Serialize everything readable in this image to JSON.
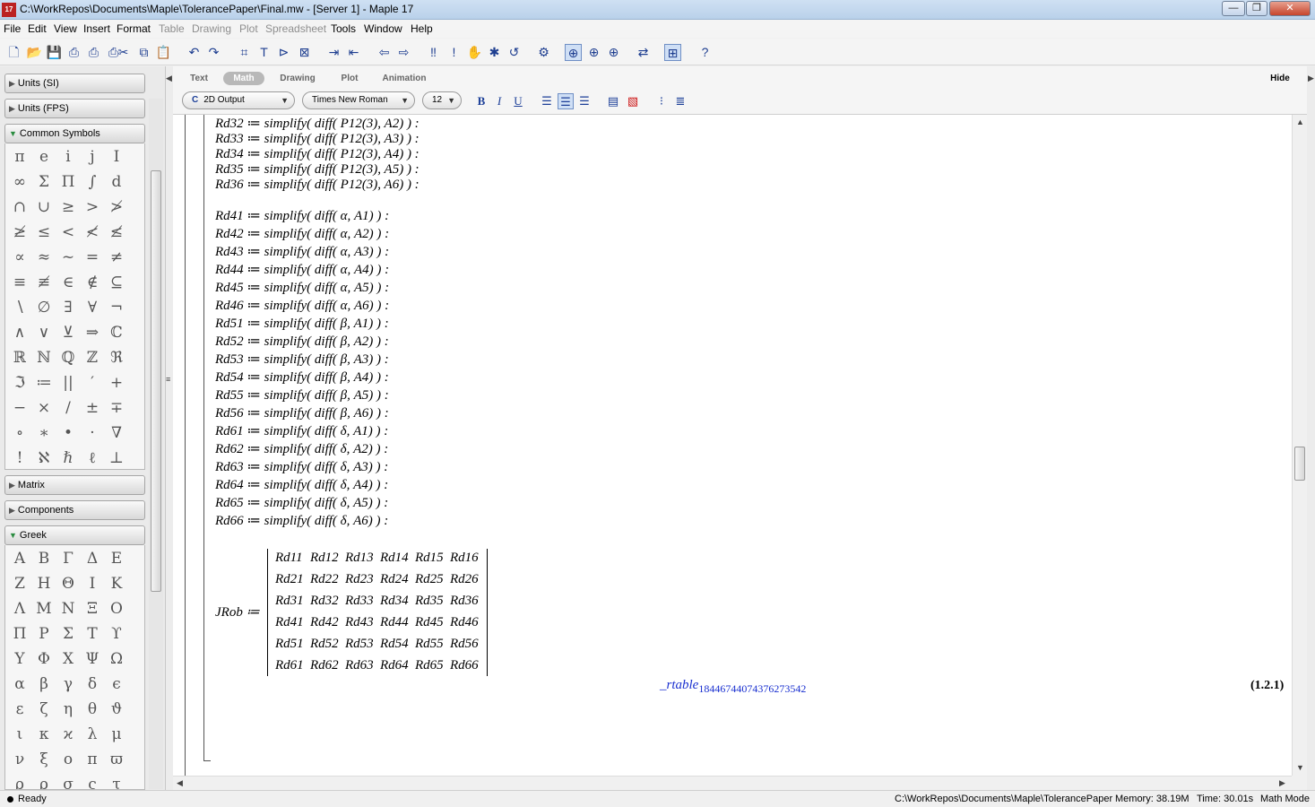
{
  "window": {
    "title": "C:\\WorkRepos\\Documents\\Maple\\TolerancePaper\\Final.mw - [Server 1] - Maple 17",
    "app_icon_label": "17",
    "minimize": "—",
    "maximize": "❐",
    "close": "✕"
  },
  "menu": [
    {
      "label": "File",
      "enabled": true
    },
    {
      "label": "Edit",
      "enabled": true
    },
    {
      "label": "View",
      "enabled": true
    },
    {
      "label": "Insert",
      "enabled": true
    },
    {
      "label": "Format",
      "enabled": true
    },
    {
      "label": "Table",
      "enabled": false
    },
    {
      "label": "Drawing",
      "enabled": false
    },
    {
      "label": "Plot",
      "enabled": false
    },
    {
      "label": "Spreadsheet",
      "enabled": false
    },
    {
      "label": "Tools",
      "enabled": true
    },
    {
      "label": "Window",
      "enabled": true
    },
    {
      "label": "Help",
      "enabled": true
    }
  ],
  "toolbar_icons": [
    "new-icon",
    "open-icon",
    "save-icon",
    "print-icon",
    "print-preview-icon",
    "print-setup-icon",
    "cut-icon",
    "copy-icon",
    "paste-icon",
    "undo-icon",
    "redo-icon",
    "insert-math-icon",
    "insert-text-icon",
    "insert-prompt-icon",
    "insert-execution-group-icon",
    "indent-icon",
    "outdent-icon",
    "back-icon",
    "forward-icon",
    "execute-all-icon",
    "execute-icon",
    "stop-icon",
    "debug-icon",
    "restart-icon",
    "settings-icon",
    "zoom-100-icon",
    "zoom-150-icon",
    "zoom-200-icon",
    "toggle-icon",
    "expand-icon",
    "help-icon"
  ],
  "palettes": {
    "units_si": "Units (SI)",
    "units_fps": "Units (FPS)",
    "common_symbols": "Common Symbols",
    "common_symbols_items": [
      "π",
      "e",
      "i",
      "j",
      "I",
      "∞",
      "Σ",
      "Π",
      "∫",
      "d",
      "∩",
      "∪",
      "≥",
      ">",
      "≯",
      "≱",
      "≤",
      "<",
      "≮",
      "≰",
      "∝",
      "≈",
      "~",
      "=",
      "≠",
      "≡",
      "≢",
      "∈",
      "∉",
      "⊆",
      "∖",
      "∅",
      "∃",
      "∀",
      "¬",
      "∧",
      "∨",
      "⊻",
      "⇒",
      "ℂ",
      "ℝ",
      "ℕ",
      "ℚ",
      "ℤ",
      "ℜ",
      "ℑ",
      "≔",
      "||",
      "′",
      "+",
      "−",
      "×",
      "/",
      "±",
      "∓",
      "∘",
      "∗",
      "•",
      "·",
      "∇",
      "!",
      "ℵ",
      "ℏ",
      "ℓ",
      "⊥"
    ],
    "matrix": "Matrix",
    "components": "Components",
    "greek": "Greek",
    "greek_items": [
      "Α",
      "Β",
      "Γ",
      "Δ",
      "Ε",
      "Ζ",
      "Η",
      "Θ",
      "Ι",
      "Κ",
      "Λ",
      "Μ",
      "Ν",
      "Ξ",
      "Ο",
      "Π",
      "Ρ",
      "Σ",
      "Τ",
      "ϒ",
      "Υ",
      "Φ",
      "Χ",
      "Ψ",
      "Ω",
      "α",
      "β",
      "γ",
      "δ",
      "ϵ",
      "ε",
      "ζ",
      "η",
      "θ",
      "ϑ",
      "ι",
      "κ",
      "ϰ",
      "λ",
      "μ",
      "ν",
      "ξ",
      "ο",
      "π",
      "ϖ",
      "ρ",
      "ϱ",
      "σ",
      "ς",
      "τ"
    ]
  },
  "context_bar": {
    "tabs": [
      "Text",
      "Math",
      "Drawing",
      "Plot",
      "Animation"
    ],
    "active_tab": "Math",
    "hide": "Hide",
    "output_style": "2D Output",
    "font": "Times New Roman",
    "font_size": "12",
    "bold": "B",
    "italic": "I",
    "underline": "U"
  },
  "document": {
    "lines": [
      "Rd32 ≔ simplify( diff( P12(3), A2) ) :",
      "Rd33 ≔ simplify( diff( P12(3), A3) ) :",
      "Rd34 ≔ simplify( diff( P12(3), A4) ) :",
      "Rd35 ≔ simplify( diff( P12(3), A5) ) :",
      "Rd36 ≔ simplify( diff( P12(3), A6) ) :",
      "Rd41 ≔ simplify( diff( α, A1) ) :",
      "Rd42 ≔ simplify( diff( α, A2) ) :",
      "Rd43 ≔ simplify( diff( α, A3) ) :",
      "Rd44 ≔ simplify( diff( α, A4) ) :",
      "Rd45 ≔ simplify( diff( α, A5) ) :",
      "Rd46 ≔ simplify( diff( α, A6) ) :",
      "Rd51 ≔ simplify( diff( β, A1) ) :",
      "Rd52 ≔ simplify( diff( β, A2) ) :",
      "Rd53 ≔ simplify( diff( β, A3) ) :",
      "Rd54 ≔ simplify( diff( β, A4) ) :",
      "Rd55 ≔ simplify( diff( β, A5) ) :",
      "Rd56 ≔ simplify( diff( β, A6) ) :",
      "Rd61 ≔ simplify( diff( δ, A1) ) :",
      "Rd62 ≔ simplify( diff( δ, A2) ) :",
      "Rd63 ≔ simplify( diff( δ, A3) ) :",
      "Rd64 ≔ simplify( diff( δ, A4) ) :",
      "Rd65 ≔ simplify( diff( δ, A5) ) :",
      "Rd66 ≔ simplify( diff( δ, A6) ) :"
    ],
    "jrob_label": "JRob ≔",
    "matrix": [
      [
        "Rd11",
        "Rd12",
        "Rd13",
        "Rd14",
        "Rd15",
        "Rd16"
      ],
      [
        "Rd21",
        "Rd22",
        "Rd23",
        "Rd24",
        "Rd25",
        "Rd26"
      ],
      [
        "Rd31",
        "Rd32",
        "Rd33",
        "Rd34",
        "Rd35",
        "Rd36"
      ],
      [
        "Rd41",
        "Rd42",
        "Rd43",
        "Rd44",
        "Rd45",
        "Rd46"
      ],
      [
        "Rd51",
        "Rd52",
        "Rd53",
        "Rd54",
        "Rd55",
        "Rd56"
      ],
      [
        "Rd61",
        "Rd62",
        "Rd63",
        "Rd64",
        "Rd65",
        "Rd66"
      ]
    ],
    "output_name": "_rtable",
    "output_subscript": "18446744074376273542",
    "equation_label": "(1.2.1)"
  },
  "status": {
    "state": "Ready",
    "path": "C:\\WorkRepos\\Documents\\Maple\\TolerancePaper",
    "memory": "Memory: 38.19M",
    "time": "Time: 30.01s",
    "mode": "Math Mode"
  }
}
